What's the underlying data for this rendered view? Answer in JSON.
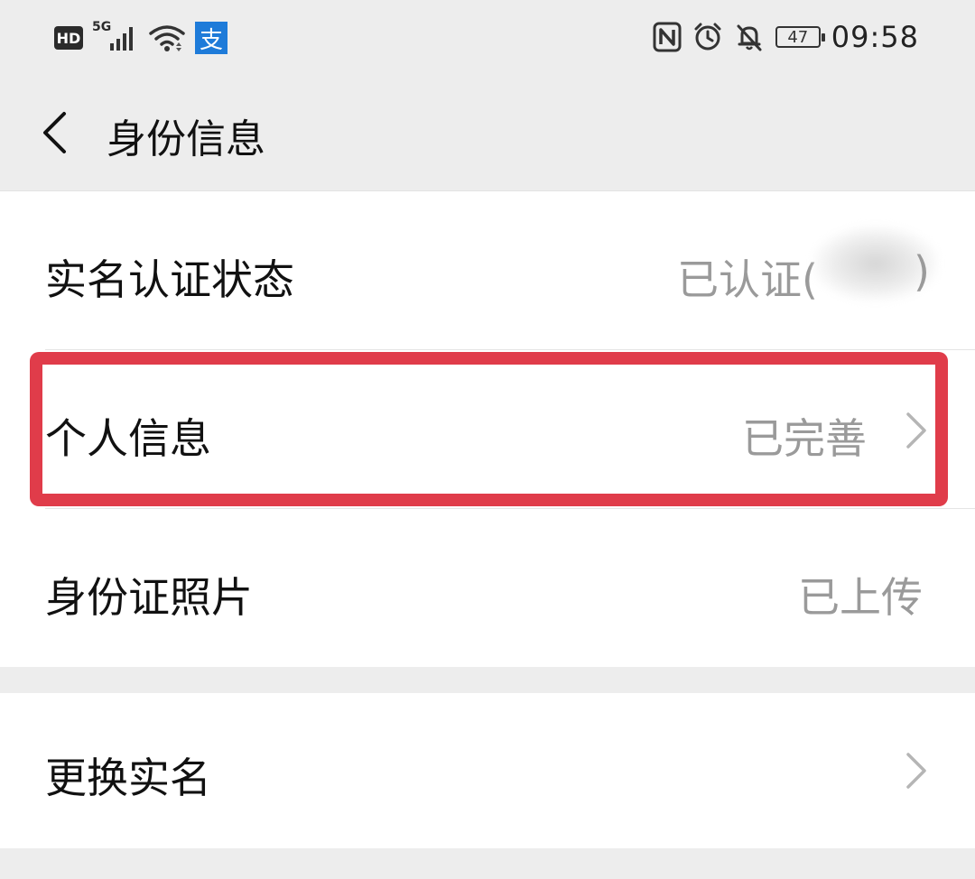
{
  "status_bar": {
    "hd_label": "HD",
    "network_label": "5G",
    "alipay_glyph": "支",
    "battery_level": "47",
    "time": "09:58",
    "icons": [
      "hd-icon",
      "signal-icon",
      "wifi-icon",
      "alipay-icon",
      "nfc-icon",
      "alarm-icon",
      "mute-icon",
      "battery-icon"
    ]
  },
  "nav": {
    "title": "身份信息",
    "back_icon": "chevron-left-icon"
  },
  "rows": [
    {
      "label": "实名认证状态",
      "value": "已认证(",
      "value_tail": ")",
      "has_chevron": false
    },
    {
      "label": "个人信息",
      "value": "已完善",
      "has_chevron": true
    },
    {
      "label": "身份证照片",
      "value": "已上传",
      "has_chevron": false
    },
    {
      "label": "更换实名",
      "value": "",
      "has_chevron": true
    }
  ],
  "colors": {
    "background": "#ededed",
    "card": "#ffffff",
    "highlight": "#e03c4a",
    "secondary_text": "#9a9a9a"
  }
}
